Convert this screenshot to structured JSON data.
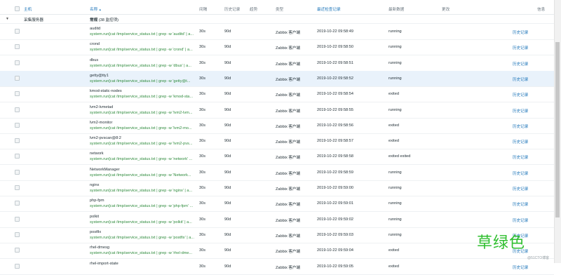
{
  "header": {
    "host": "主机",
    "name": "名称",
    "sort_indicator": "▲",
    "interval": "间隔",
    "history": "历史记录",
    "trends": "趋势",
    "type": "类型",
    "last_check": "最近检查记录",
    "last_value": "最新数据",
    "change": "更改",
    "info": "信息"
  },
  "group": {
    "caret": "▼",
    "host_name": "采集服务器",
    "app_name": "常规",
    "item_count": "(38 监控项)"
  },
  "rows": [
    {
      "name": "auditd",
      "key": "system.run[cat /tmp/service_status.txt | grep -w 'auditd' | a...",
      "interval": "30s",
      "history": "90d",
      "type": "Zabbix 客户端",
      "last_check": "2019-10-22 09:58:49",
      "last_value": "running",
      "link": "历史记录"
    },
    {
      "name": "crond",
      "key": "system.run[cat /tmp/service_status.txt | grep -w 'crond' | a...",
      "interval": "30s",
      "history": "90d",
      "type": "Zabbix 客户端",
      "last_check": "2019-10-22 09:58:50",
      "last_value": "running",
      "link": "历史记录"
    },
    {
      "name": "dbus",
      "key": "system.run[cat /tmp/service_status.txt | grep -w 'dbus' | a...",
      "interval": "30s",
      "history": "90d",
      "type": "Zabbix 客户端",
      "last_check": "2019-10-22 09:58:51",
      "last_value": "running",
      "link": "历史记录"
    },
    {
      "name": "getty@tty1",
      "key": "system.run[cat /tmp/service_status.txt | grep -w 'getty@t...",
      "interval": "30s",
      "history": "90d",
      "type": "Zabbix 客户端",
      "last_check": "2019-10-22 09:58:52",
      "last_value": "running",
      "link": "历史记录"
    },
    {
      "name": "kmod-static-nodes",
      "key": "system.run[cat /tmp/service_status.txt | grep -w 'kmod-sta...",
      "interval": "30s",
      "history": "90d",
      "type": "Zabbix 客户端",
      "last_check": "2019-10-22 09:58:54",
      "last_value": "exited",
      "link": "历史记录"
    },
    {
      "name": "lvm2-lvmetad",
      "key": "system.run[cat /tmp/service_status.txt | grep -w 'lvm2-lvm...",
      "interval": "30s",
      "history": "90d",
      "type": "Zabbix 客户端",
      "last_check": "2019-10-22 09:58:55",
      "last_value": "running",
      "link": "历史记录"
    },
    {
      "name": "lvm2-monitor",
      "key": "system.run[cat /tmp/service_status.txt | grep -w 'lvm2-mo...",
      "interval": "30s",
      "history": "90d",
      "type": "Zabbix 客户端",
      "last_check": "2019-10-22 09:58:56",
      "last_value": "exited",
      "link": "历史记录"
    },
    {
      "name": "lvm2-pvscan@8:2",
      "key": "system.run[cat /tmp/service_status.txt | grep -w 'lvm2-pvs...",
      "interval": "30s",
      "history": "90d",
      "type": "Zabbix 客户端",
      "last_check": "2019-10-22 09:58:57",
      "last_value": "exited",
      "link": "历史记录"
    },
    {
      "name": "network",
      "key": "system.run[cat /tmp/service_status.txt | grep -w 'network' ...",
      "interval": "30s",
      "history": "90d",
      "type": "Zabbix 客户端",
      "last_check": "2019-10-22 09:58:58",
      "last_value": "exited exited",
      "link": "历史记录"
    },
    {
      "name": "NetworkManager",
      "key": "system.run[cat /tmp/service_status.txt | grep -w 'Network...",
      "interval": "30s",
      "history": "90d",
      "type": "Zabbix 客户端",
      "last_check": "2019-10-22 09:58:59",
      "last_value": "running",
      "link": "历史记录"
    },
    {
      "name": "nginx",
      "key": "system.run[cat /tmp/service_status.txt | grep -w 'nginx' | a...",
      "interval": "30s",
      "history": "90d",
      "type": "Zabbix 客户端",
      "last_check": "2019-10-22 09:59:00",
      "last_value": "running",
      "link": "历史记录"
    },
    {
      "name": "php-fpm",
      "key": "system.run[cat /tmp/service_status.txt | grep -w 'php-fpm' ...",
      "interval": "30s",
      "history": "90d",
      "type": "Zabbix 客户端",
      "last_check": "2019-10-22 09:59:01",
      "last_value": "running",
      "link": "历史记录"
    },
    {
      "name": "polkit",
      "key": "system.run[cat /tmp/service_status.txt | grep -w 'polkit' | a...",
      "interval": "30s",
      "history": "90d",
      "type": "Zabbix 客户端",
      "last_check": "2019-10-22 09:59:02",
      "last_value": "running",
      "link": "历史记录"
    },
    {
      "name": "postfix",
      "key": "system.run[cat /tmp/service_status.txt | grep -w 'postfix' | a...",
      "interval": "30s",
      "history": "90d",
      "type": "Zabbix 客户端",
      "last_check": "2019-10-22 09:59:03",
      "last_value": "running",
      "link": "历史记录"
    },
    {
      "name": "rhel-dmesg",
      "key": "system.run[cat /tmp/service_status.txt | grep -w 'rhel-dme...",
      "interval": "30s",
      "history": "90d",
      "type": "Zabbix 客户端",
      "last_check": "2019-10-22 09:59:04",
      "last_value": "exited",
      "link": "历史记录"
    },
    {
      "name": "rhel-import-state",
      "key": "",
      "interval": "30s",
      "history": "90d",
      "type": "Zabbix 客户端",
      "last_check": "2019-10-22 09:59:05",
      "last_value": "exited",
      "link": "历史记录"
    }
  ],
  "watermark": "草绿色",
  "credit": "@51CTO博客"
}
